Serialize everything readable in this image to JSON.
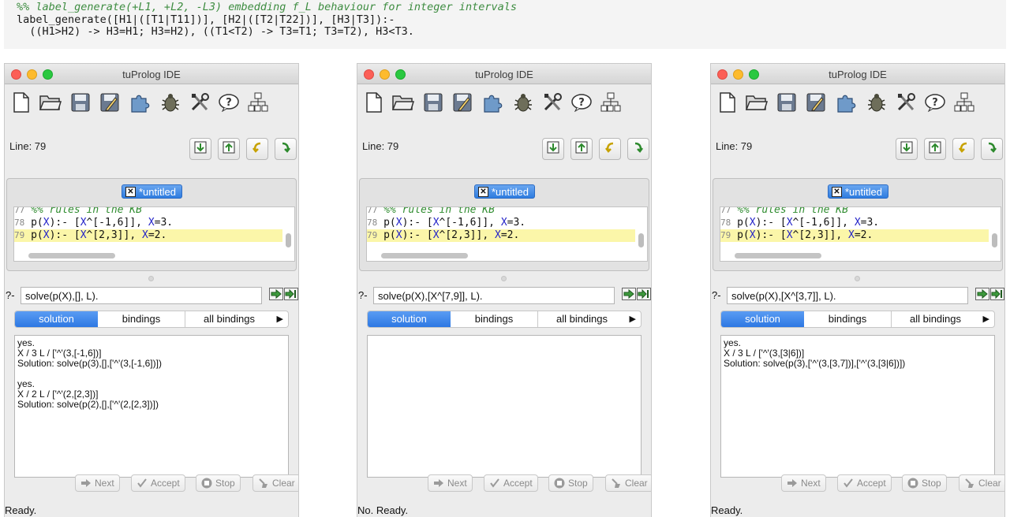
{
  "code_header": {
    "line1": "%% label_generate(+L1, +L2, -L3) embedding f_L behaviour for integer intervals",
    "line2": "label_generate([H1|([T1|T11])], [H2|([T2|T22])], [H3|T3]):-",
    "line3": "  ((H1>H2) -> H3=H1; H3=H2), ((T1<T2) -> T3=T1; T3=T2), H3<T3."
  },
  "windows": [
    {
      "title": "tuProlog IDE",
      "line_label": "Line: 79",
      "file_tab": "*untitled",
      "code_lines": {
        "l77": {
          "no": "77",
          "text": "%% rules in the KB"
        },
        "l78": {
          "no": "78",
          "a": "p(",
          "b": "X",
          "c": "):- [",
          "d": "X",
          "e": "^[-1,6]], ",
          "f": "X",
          "g": "=3."
        },
        "l79": {
          "no": "79",
          "a": "p(",
          "b": "X",
          "c": "):- [",
          "d": "X",
          "e": "^[2,3]], ",
          "f": "X",
          "g": "=2."
        }
      },
      "query_prompt": "?-",
      "query": "solve(p(X),[], L).",
      "tabs": [
        "solution",
        "bindings",
        "all bindings"
      ],
      "tab_more": "▶",
      "output": [
        "yes.",
        "X / 3  L / ['^'(3,[-1,6])]",
        "Solution: solve(p(3),[],['^'(3,[-1,6])])",
        "",
        "yes.",
        "X / 2  L / ['^'(2,[2,3])]",
        "Solution: solve(p(2),[],['^'(2,[2,3])])"
      ],
      "buttons": {
        "next": "Next",
        "accept": "Accept",
        "stop": "Stop",
        "clear": "Clear"
      },
      "status": "Ready."
    },
    {
      "title": "tuProlog IDE",
      "line_label": "Line: 79",
      "file_tab": "*untitled",
      "code_lines": {
        "l77": {
          "no": "77",
          "text": "%% rules in the KB"
        },
        "l78": {
          "no": "78",
          "a": "p(",
          "b": "X",
          "c": "):- [",
          "d": "X",
          "e": "^[-1,6]], ",
          "f": "X",
          "g": "=3."
        },
        "l79": {
          "no": "79",
          "a": "p(",
          "b": "X",
          "c": "):- [",
          "d": "X",
          "e": "^[2,3]], ",
          "f": "X",
          "g": "=2."
        }
      },
      "query_prompt": "?-",
      "query": "solve(p(X),[X^[7,9]], L).",
      "tabs": [
        "solution",
        "bindings",
        "all bindings"
      ],
      "tab_more": "▶",
      "output": [],
      "buttons": {
        "next": "Next",
        "accept": "Accept",
        "stop": "Stop",
        "clear": "Clear"
      },
      "status": "No. Ready."
    },
    {
      "title": "tuProlog IDE",
      "line_label": "Line: 79",
      "file_tab": "*untitled",
      "code_lines": {
        "l77": {
          "no": "77",
          "text": "%% rules in the KB"
        },
        "l78": {
          "no": "78",
          "a": "p(",
          "b": "X",
          "c": "):- [",
          "d": "X",
          "e": "^[-1,6]], ",
          "f": "X",
          "g": "=3."
        },
        "l79": {
          "no": "79",
          "a": "p(",
          "b": "X",
          "c": "):- [",
          "d": "X",
          "e": "^[2,3]], ",
          "f": "X",
          "g": "=2."
        }
      },
      "query_prompt": "?-",
      "query": "solve(p(X),[X^[3,7]], L).",
      "tabs": [
        "solution",
        "bindings",
        "all bindings"
      ],
      "tab_more": "▶",
      "output": [
        "yes.",
        "X / 3  L / ['^'(3,[3|6])]",
        "Solution: solve(p(3),['^'(3,[3,7])],['^'(3,[3|6])])"
      ],
      "buttons": {
        "next": "Next",
        "accept": "Accept",
        "stop": "Stop",
        "clear": "Clear"
      },
      "status": "Ready."
    }
  ],
  "colors": {
    "tab_selected": "#2d78e3",
    "highlight_line": "#fbf6a9",
    "comment": "#2f8c2f",
    "variable": "#2424c8"
  },
  "icons": [
    "new-file-icon",
    "open-folder-icon",
    "save-icon",
    "save-as-icon",
    "puzzle-icon",
    "bug-icon",
    "tools-icon",
    "help-icon",
    "hierarchy-icon",
    "download-icon",
    "upload-icon",
    "undo-icon",
    "redo-icon"
  ]
}
